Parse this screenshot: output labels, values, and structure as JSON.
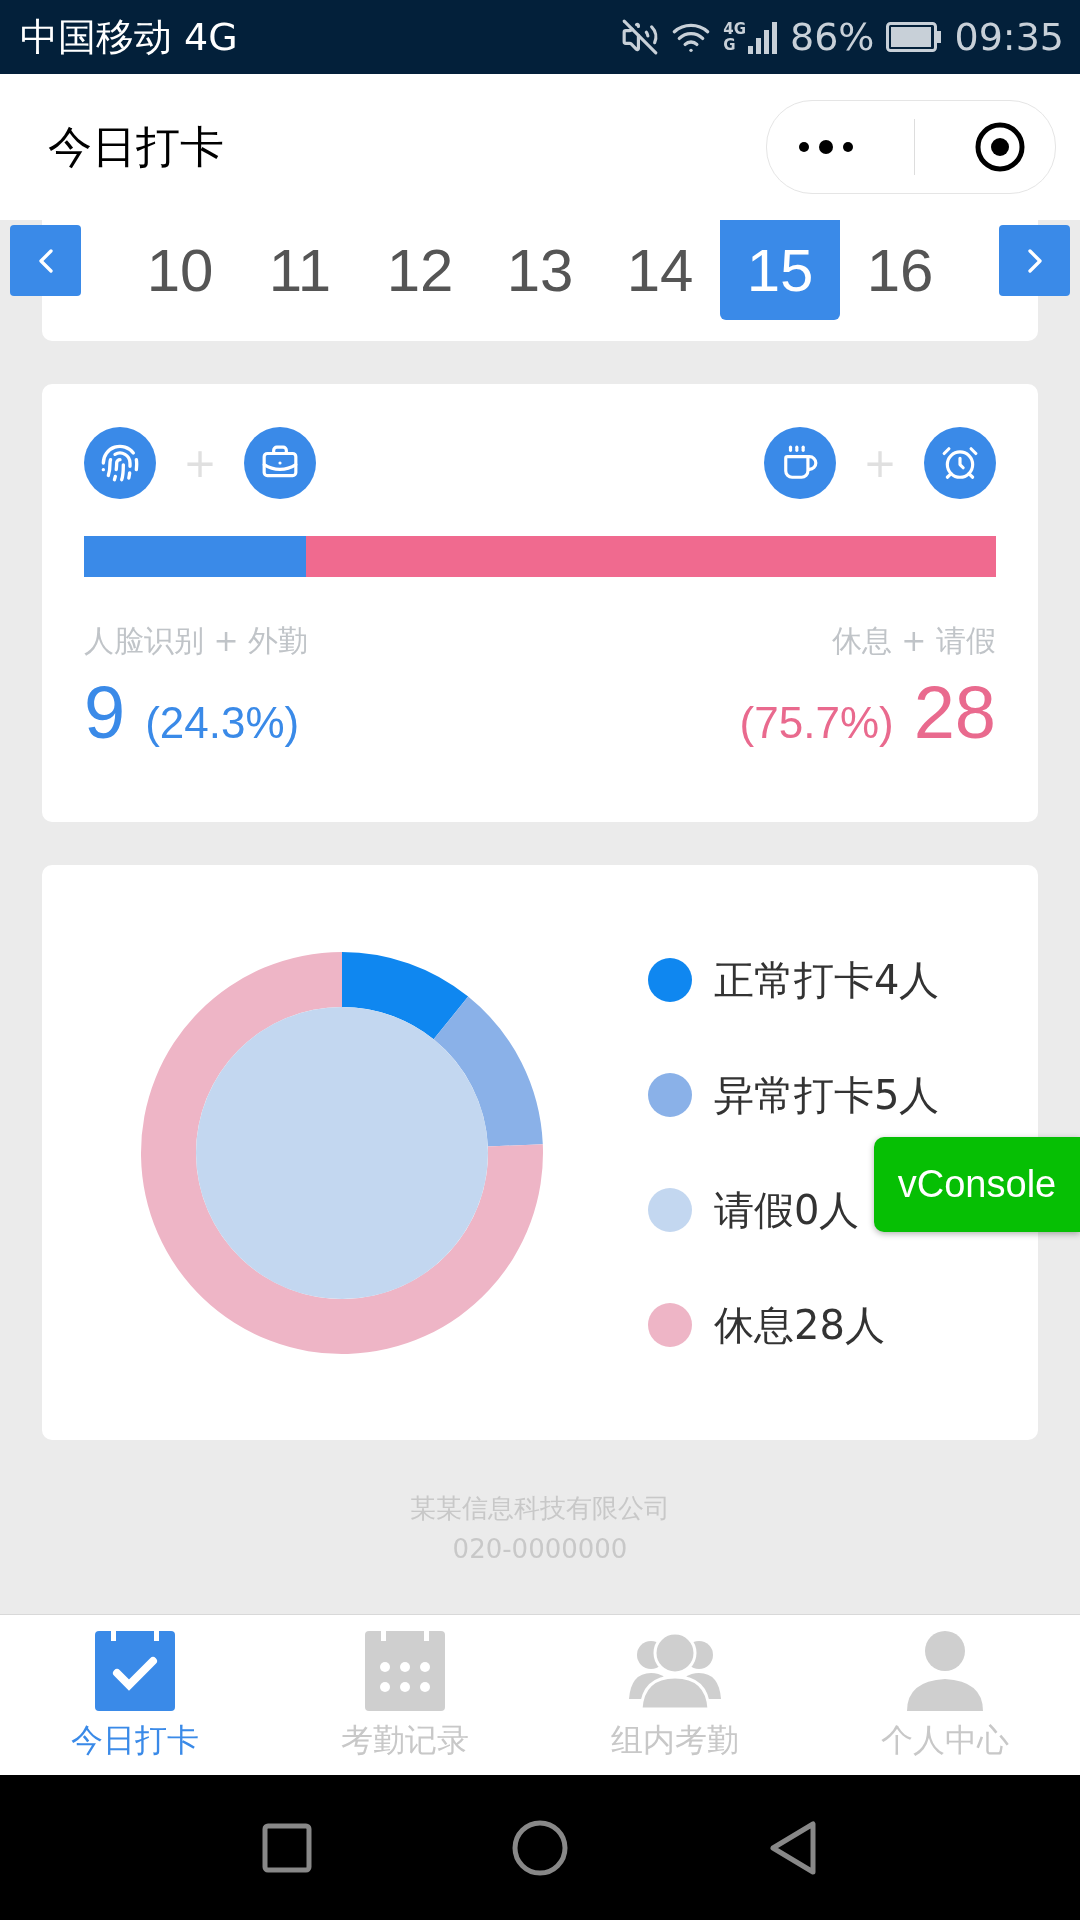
{
  "status_bar": {
    "carrier": "中国移动 4G",
    "net_top": "4G",
    "net_bottom": "G",
    "battery": "86%",
    "time": "09:35"
  },
  "header": {
    "title": "今日打卡"
  },
  "date_strip": {
    "dates": [
      {
        "label": "10",
        "selected": false
      },
      {
        "label": "11",
        "selected": false
      },
      {
        "label": "12",
        "selected": false
      },
      {
        "label": "13",
        "selected": false
      },
      {
        "label": "14",
        "selected": false
      },
      {
        "label": "15",
        "selected": true
      },
      {
        "label": "16",
        "selected": false
      }
    ]
  },
  "summary": {
    "level": 0.243,
    "plus_left": "+",
    "plus_right": "+",
    "left": {
      "label": "人脸识别 + 外勤",
      "count": "9",
      "percent": "(24.3%)"
    },
    "right": {
      "label": "休息 + 请假",
      "percent": "(75.7%)",
      "count": "28"
    }
  },
  "distribution": {
    "chart_data": {
      "type": "donut",
      "values": [
        10.8,
        13.5,
        0,
        75.7
      ]
    },
    "legend": [
      {
        "label": "正常打卡4人",
        "color": "#0f87f0"
      },
      {
        "label": "异常打卡5人",
        "color": "#8ab1e8"
      },
      {
        "label": "请假0人",
        "color": "#c3d7f0"
      },
      {
        "label": "休息28人",
        "color": "#eeb5c6"
      }
    ]
  },
  "footer": {
    "company": "某某信息科技有限公司",
    "phone": "020-0000000"
  },
  "tab_bar": [
    {
      "label": "今日打卡",
      "selected": true,
      "kind": "today"
    },
    {
      "label": "考勤记录",
      "selected": false,
      "kind": "records"
    },
    {
      "label": "组内考勤",
      "selected": false,
      "kind": "group"
    },
    {
      "label": "个人中心",
      "selected": false,
      "kind": "profile"
    }
  ],
  "vconsole": {
    "label": "vConsole"
  }
}
